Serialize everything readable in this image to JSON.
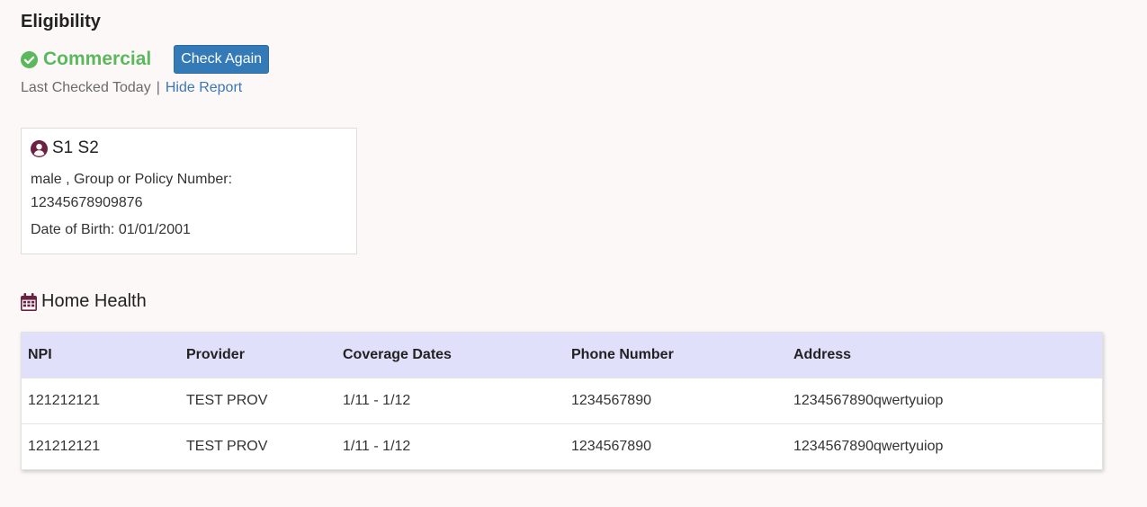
{
  "header": {
    "title": "Eligibility"
  },
  "status": {
    "plan_type": "Commercial",
    "check_again_label": "Check Again",
    "last_checked": "Last Checked Today",
    "separator": "|",
    "hide_report_label": "Hide Report",
    "success_color": "#5cb85c",
    "button_color": "#337ab7"
  },
  "patient": {
    "name": "S1 S2",
    "gender_policy_line": "male , Group or Policy Number:",
    "policy_number": "12345678909876",
    "dob_line": "Date of Birth: 01/01/2001",
    "icon": "user-circle-icon"
  },
  "home_health": {
    "title": "Home Health",
    "icon": "calendar-icon",
    "columns": [
      "NPI",
      "Provider",
      "Coverage Dates",
      "Phone Number",
      "Address"
    ],
    "rows": [
      [
        "121212121",
        "TEST PROV",
        "1/11 - 1/12",
        "1234567890",
        "1234567890qwertyuiop"
      ],
      [
        "121212121",
        "TEST PROV",
        "1/11 - 1/12",
        "1234567890",
        "1234567890qwertyuiop"
      ]
    ],
    "header_color": "#e0e0fb"
  }
}
